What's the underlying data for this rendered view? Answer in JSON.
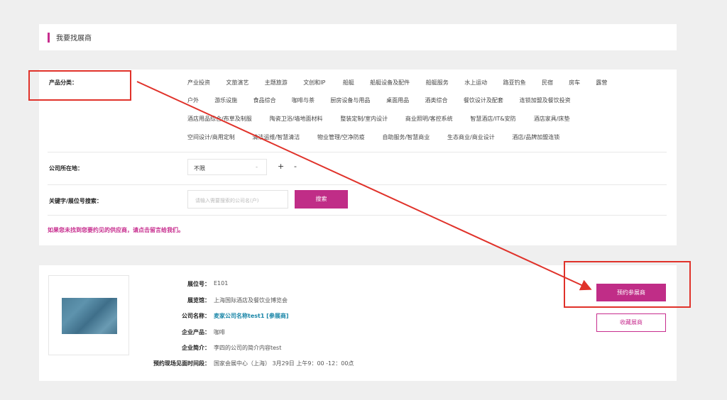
{
  "header": {
    "title": "我要找展商"
  },
  "filter": {
    "category_label": "产品分类：",
    "category_rows": [
      [
        "产业投资",
        "文旅演艺",
        "主题旅游",
        "文创和IP",
        "船艇",
        "船艇设备及配件",
        "船艇服务",
        "水上运动",
        "路亚钓鱼",
        "民宿",
        "房车",
        "露营"
      ],
      [
        "户外",
        "游乐设施",
        "食品综合",
        "咖啡与茶",
        "厨房设备与用品",
        "桌面用品",
        "酒类综合",
        "餐饮设计及配套",
        "连锁加盟及餐饮投资"
      ],
      [
        "酒店用品综合/布草及制服",
        "陶瓷卫浴/墙地面材料",
        "整装定制/室内设计",
        "商业照明/客控系统",
        "智慧酒店/IT&安防",
        "酒店家具/床垫"
      ],
      [
        "空间设计/商用定制",
        "清洁运维/智慧清洁",
        "物业管理/空净防疫",
        "自助服务/智慧商业",
        "生态商业/商业设计",
        "酒店/品牌加盟连锁"
      ]
    ],
    "location_label": "公司所在地：",
    "location_value": "不限",
    "location_dash": "-",
    "plus": "+",
    "minus": "-",
    "keyword_label": "关键字/展位号搜索：",
    "search_placeholder": "请输入需要搜索的公司名(户)",
    "search_button": "搜索",
    "notice": "如果您未找到您要约见的供应商，请点击留言给我们。"
  },
  "result": {
    "booth_label": "展位号：",
    "booth_value": "E101",
    "hall_label": "展览馆：",
    "hall_value": "上海国际酒店及餐饮业博览会",
    "company_label": "公司名称：",
    "company_value": "麦家公司名称test1 [参展商]",
    "product_label": "企业产品：",
    "product_value": "咖啡",
    "intro_label": "企业简介：",
    "intro_value": "李四的公司的简介内容test",
    "time_label": "预约现场见面时间段：",
    "time_value": "国家会展中心（上海） 3月29日 上午9：00 -12：00点",
    "book_button": "预约参展商",
    "favorite_button": "收藏展商"
  },
  "annotation": {
    "color": "#e0322a"
  },
  "colors": {
    "accent": "#c02d87",
    "link": "#1a86a8"
  }
}
